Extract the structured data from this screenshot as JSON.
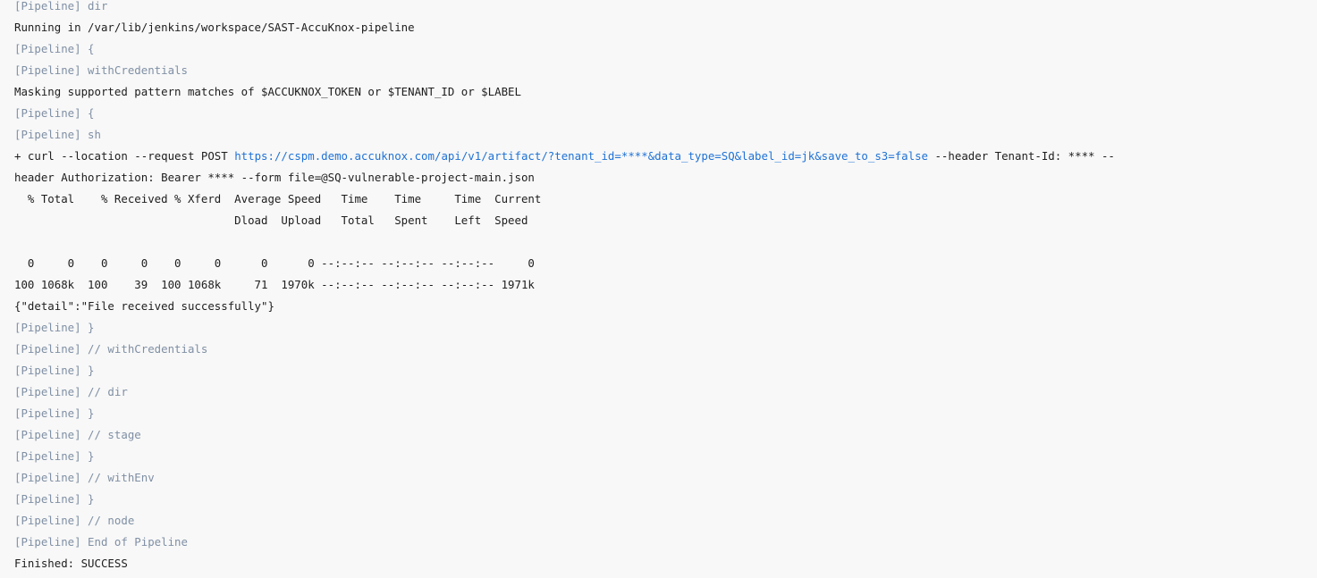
{
  "console": {
    "lines": [
      {
        "type": "pipeline",
        "text": "[Pipeline] dir"
      },
      {
        "type": "output",
        "text": "Running in /var/lib/jenkins/workspace/SAST-AccuKnox-pipeline"
      },
      {
        "type": "pipeline",
        "text": "[Pipeline] {"
      },
      {
        "type": "pipeline",
        "text": "[Pipeline] withCredentials"
      },
      {
        "type": "output",
        "text": "Masking supported pattern matches of $ACCUKNOX_TOKEN or $TENANT_ID or $LABEL"
      },
      {
        "type": "pipeline",
        "text": "[Pipeline] {"
      },
      {
        "type": "pipeline",
        "text": "[Pipeline] sh"
      },
      {
        "type": "output",
        "text": "+ curl --location --request POST "
      },
      {
        "type": "output",
        "text": "header Authorization: Bearer **** --form file=@SQ-vulnerable-project-main.json"
      },
      {
        "type": "output",
        "text": "  % Total    % Received % Xferd  Average Speed   Time    Time     Time  Current"
      },
      {
        "type": "output",
        "text": "                                 Dload  Upload   Total   Spent    Left  Speed"
      },
      {
        "type": "output",
        "text": ""
      },
      {
        "type": "output",
        "text": "  0     0    0     0    0     0      0      0 --:--:-- --:--:-- --:--:--     0"
      },
      {
        "type": "output",
        "text": "100 1068k  100    39  100 1068k     71  1970k --:--:-- --:--:-- --:--:-- 1971k"
      },
      {
        "type": "output",
        "text": "{\"detail\":\"File received successfully\"}"
      },
      {
        "type": "pipeline",
        "text": "[Pipeline] }"
      },
      {
        "type": "pipeline",
        "text": "[Pipeline] // withCredentials"
      },
      {
        "type": "pipeline",
        "text": "[Pipeline] }"
      },
      {
        "type": "pipeline",
        "text": "[Pipeline] // dir"
      },
      {
        "type": "pipeline",
        "text": "[Pipeline] }"
      },
      {
        "type": "pipeline",
        "text": "[Pipeline] // stage"
      },
      {
        "type": "pipeline",
        "text": "[Pipeline] }"
      },
      {
        "type": "pipeline",
        "text": "[Pipeline] // withEnv"
      },
      {
        "type": "pipeline",
        "text": "[Pipeline] }"
      },
      {
        "type": "pipeline",
        "text": "[Pipeline] // node"
      },
      {
        "type": "pipeline",
        "text": "[Pipeline] End of Pipeline"
      },
      {
        "type": "output",
        "text": "Finished: SUCCESS"
      }
    ],
    "curl_url": "https://cspm.demo.accuknox.com/api/v1/artifact/?tenant_id=****&data_type=SQ&label_id=jk&save_to_s3=false",
    "curl_suffix": " --header Tenant-Id: **** --"
  },
  "colors": {
    "background": "#f8f8f8",
    "text": "#1d1d1d",
    "pipeline": "#7f8fa4",
    "link": "#1e72d6"
  }
}
